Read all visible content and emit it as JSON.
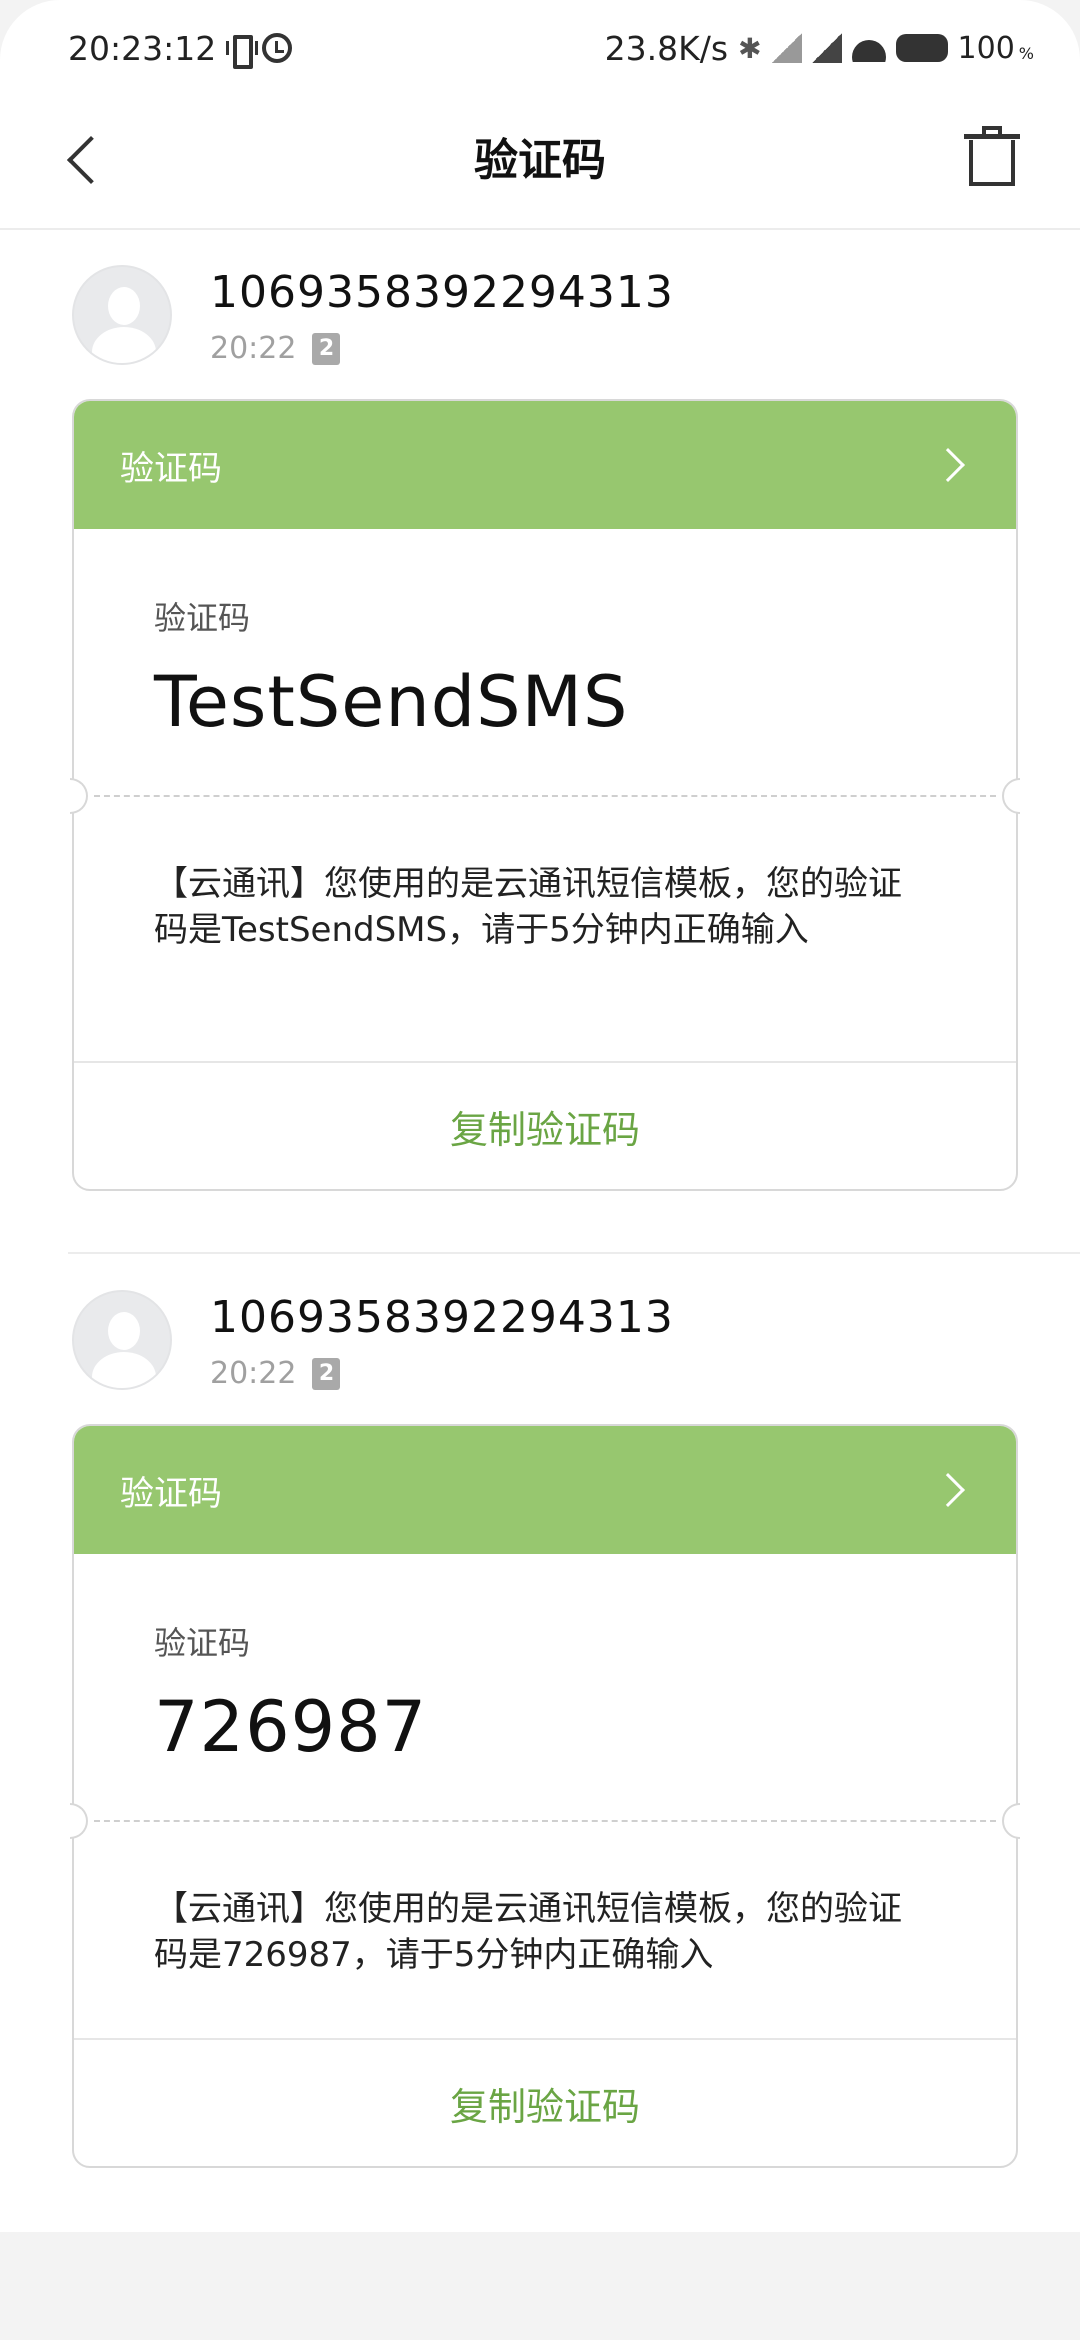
{
  "status_bar": {
    "time": "20:23:12",
    "net_speed": "23.8K/s",
    "battery": "100",
    "battery_unit": "%"
  },
  "header": {
    "title": "验证码",
    "icons": [
      "back-icon",
      "trash-icon"
    ]
  },
  "messages": [
    {
      "sender": "1069358392294313",
      "time": "20:22",
      "sim": "2",
      "card_title": "验证码",
      "code_label": "验证码",
      "code": "TestSendSMS",
      "text": "【云通讯】您使用的是云通讯短信模板，您的验证码是TestSendSMS，请于5分钟内正确输入",
      "copy_label": "复制验证码"
    },
    {
      "sender": "1069358392294313",
      "time": "20:22",
      "sim": "2",
      "card_title": "验证码",
      "code_label": "验证码",
      "code": "726987",
      "text": "【云通讯】您使用的是云通讯短信模板，您的验证码是726987，请于5分钟内正确输入",
      "copy_label": "复制验证码"
    }
  ],
  "colors": {
    "accent_green": "#97c76f",
    "copy_green": "#6aa544"
  }
}
